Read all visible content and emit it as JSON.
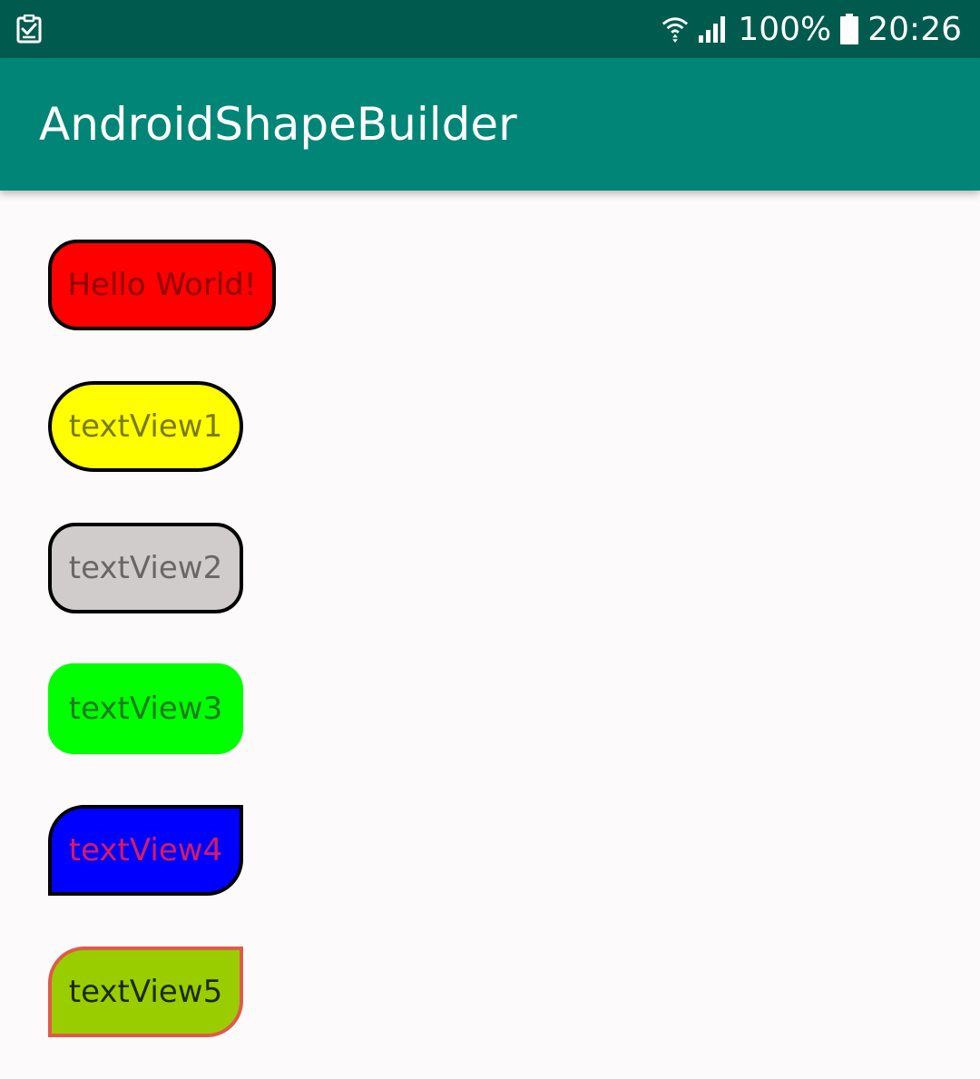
{
  "status_bar": {
    "left_icon": "task-check-icon",
    "wifi_icon": "wifi-icon",
    "signal_icon": "cellular-signal-icon",
    "battery_percent": "100%",
    "battery_icon": "battery-full-icon",
    "time": "20:26",
    "background_color": "#005b4e"
  },
  "app_bar": {
    "title": "AndroidShapeBuilder",
    "background_color": "#008577"
  },
  "text_views": [
    {
      "label": "Hello World!",
      "fill": "#ff0000",
      "stroke": "#000000"
    },
    {
      "label": "textView1",
      "fill": "#ffff00",
      "stroke": "#000000"
    },
    {
      "label": "textView2",
      "fill": "#d0cccc",
      "stroke": "#000000"
    },
    {
      "label": "textView3",
      "fill": "#00ff00",
      "stroke": ""
    },
    {
      "label": "textView4",
      "fill": "#0000ff",
      "stroke": "#000000"
    },
    {
      "label": "textView5",
      "fill": "#9acd00",
      "stroke": "#e05a4a"
    }
  ]
}
